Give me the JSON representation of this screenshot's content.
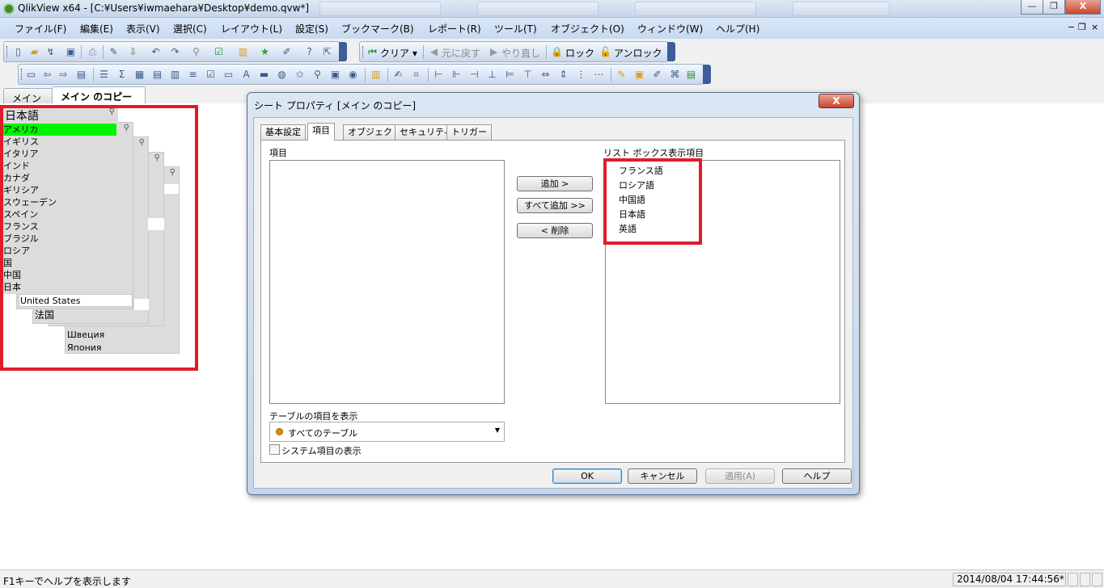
{
  "window": {
    "title": "QlikView x64 - [C:¥Users¥iwmaehara¥Desktop¥demo.qvw*]",
    "min_label": "—",
    "restore_label": "❐",
    "close_label": "X"
  },
  "menubar": {
    "items": [
      "ファイル(F)",
      "編集(E)",
      "表示(V)",
      "選択(C)",
      "レイアウト(L)",
      "設定(S)",
      "ブックマーク(B)",
      "レポート(R)",
      "ツール(T)",
      "オブジェクト(O)",
      "ウィンドウ(W)",
      "ヘルプ(H)"
    ],
    "mdi_min": "−",
    "mdi_restore": "❐",
    "mdi_close": "×"
  },
  "toolbar": {
    "clear_label": "クリア ▾",
    "back_label": "元に戻す",
    "forward_label": "やり直し",
    "lock_label": "ロック",
    "unlock_label": "アンロック"
  },
  "tabs": [
    {
      "label": "メイン"
    },
    {
      "label": "メイン のコピー"
    }
  ],
  "listbox": {
    "caption": "日本語",
    "items": [
      "アメリカ",
      "イギリス",
      "イタリア",
      "インド",
      "カナダ",
      "ギリシア",
      "スウェーデン",
      "スペイン",
      "フランス",
      "ブラジル",
      "ロシア",
      "国",
      "中国",
      "日本"
    ],
    "under_en": "United States",
    "under_zh": "法国",
    "under_ru": [
      "Швеция",
      "Япония"
    ]
  },
  "dialog": {
    "title": "シート プロパティ [メイン のコピー]",
    "close_label": "X",
    "tabs": [
      "基本設定",
      "項目",
      "オブジェクト",
      "セキュリティ",
      "トリガー"
    ],
    "available_label": "項目",
    "display_label": "リスト ボックス表示項目",
    "add_label": "追加 >",
    "add_all_label": "すべて追加 >>",
    "remove_label": "< 削除",
    "display_items": [
      "フランス語",
      "ロシア語",
      "中国語",
      "日本語",
      "英語"
    ],
    "show_fields_label": "テーブルの項目を表示",
    "table_value": "すべてのテーブル",
    "system_fields_label": "システム項目の表示",
    "ok_label": "OK",
    "cancel_label": "キャンセル",
    "apply_label": "適用(A)",
    "help_label": "ヘルプ"
  },
  "statusbar": {
    "hint": "F1キーでヘルプを表示します",
    "timestamp": "2014/08/04 17:44:56*"
  },
  "colors": {
    "selected_green": "#00f500",
    "highlight_red": "#e01c2a",
    "accent_orange": "#e08a00"
  }
}
